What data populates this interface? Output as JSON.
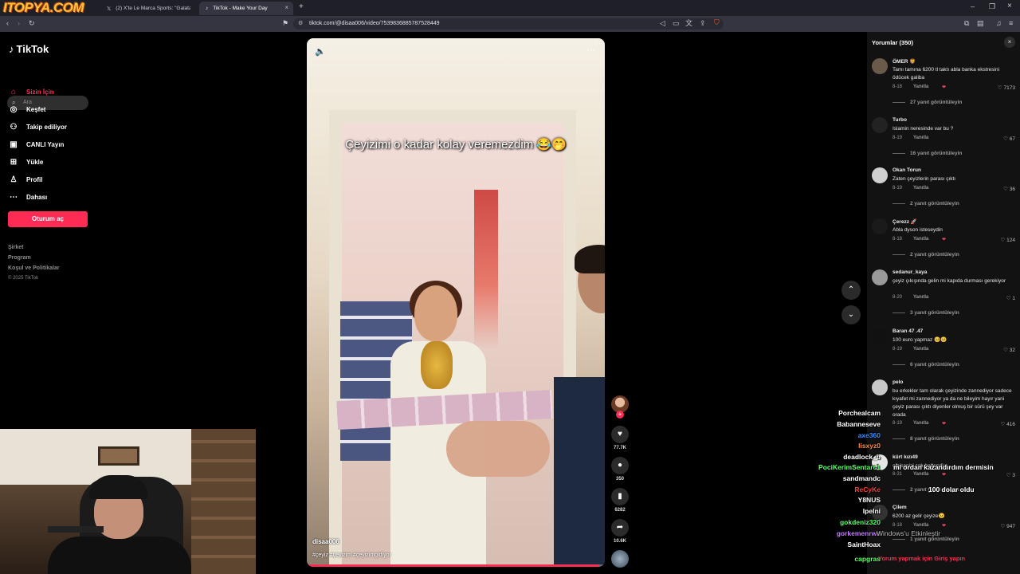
{
  "browser": {
    "watermark": "ITOPYA.COM",
    "tabs": [
      {
        "title": "(2) X'te Le Marca Sports: \"Galatasaray",
        "icon": "x"
      },
      {
        "title": "TikTok - Make Your Day",
        "icon": "tiktok",
        "active": true
      }
    ],
    "new_tab_label": "+",
    "url": "tiktok.com/@disaa006/video/7539836885787528449"
  },
  "sidebar": {
    "logo_text": "TikTok",
    "search_placeholder": "Ara",
    "nav": [
      {
        "label": "Sizin İçin",
        "icon": "home-icon",
        "active": true
      },
      {
        "label": "Keşfet",
        "icon": "compass-icon"
      },
      {
        "label": "Takip ediliyor",
        "icon": "following-icon"
      },
      {
        "label": "CANLI Yayın",
        "icon": "live-icon"
      },
      {
        "label": "Yükle",
        "icon": "upload-icon"
      },
      {
        "label": "Profil",
        "icon": "profile-icon"
      },
      {
        "label": "Dahası",
        "icon": "more-icon"
      }
    ],
    "login_button": "Oturum aç",
    "footer": [
      "Şirket",
      "Program",
      "Koşul ve Politikalar",
      "© 2025 TikTok"
    ]
  },
  "video": {
    "caption": "Çeyizimi o kadar kolay veremezdim 😂🤭",
    "username": "disaa006",
    "hashtags": "#çeyiz #çeyizim #çeyizimgidiyor",
    "progress": 0.98,
    "actions": {
      "likes": "77.7K",
      "comments": "350",
      "saves": "6282",
      "shares": "10.6K"
    }
  },
  "comments_panel": {
    "title": "Yorumlar (350)",
    "reply_label": "Yanıtla",
    "items": [
      {
        "user": "ÖMER 🦁",
        "text": "Tamı tamına 6200 tl taktı abla banka ekstresini ödücek galiba",
        "date": "8-18",
        "likes": "7173",
        "views": "27 yanıt görüntüleyin"
      },
      {
        "user": "Turbo",
        "text": "Islamin neresinde var bu ?",
        "date": "8-19",
        "likes": "67",
        "views": "16 yanıt görüntüleyin"
      },
      {
        "user": "Okan Torun",
        "text": "Zaten çeyizlerin parası çıktı",
        "date": "8-19",
        "likes": "36",
        "views": "2 yanıt görüntüleyin"
      },
      {
        "user": "Çerezz 🚀",
        "text": "Abla dyson isteseydin",
        "date": "8-18",
        "likes": "124",
        "views": "2 yanıt görüntüleyin"
      },
      {
        "user": "sedanur_kaya",
        "text": "çeyiz çıkışında gelin mi kapıda durması gerekiyor",
        "date": "8-20",
        "likes": "1",
        "views": "3 yanıt görüntüleyin"
      },
      {
        "user": "Baran 47 .47",
        "text": "100 euro yapmaz 🥺🥺",
        "date": "8-19",
        "likes": "32",
        "views": "6 yanıt görüntüleyin"
      },
      {
        "user": "pelo",
        "text": "bu erkekler tam olarak çeyizinde zannediyor sadece kıyafet mi zannediyor ya da ne bileyim hayır yani çeyiz parası çıktı diyenler olmuş bir sürü şey var orada",
        "date": "8-19",
        "likes": "416",
        "views": "8 yanıt görüntüleyin"
      },
      {
        "user": "kürt kızı49",
        "text": "elbisenizi çok beğendim",
        "date": "8-31",
        "likes": "3",
        "views": "2 yanıt görüntüleyin"
      },
      {
        "user": "Çilem",
        "text": "6200 az gelir çeyize😉",
        "date": "8-18",
        "likes": "947",
        "views": "1 yanıt görüntüleyin"
      }
    ],
    "login_prompt": "Yorum yapmak için Giriş yapın"
  },
  "stream_chat": {
    "names": [
      {
        "name": "Porchealcam",
        "color": "#ffffff"
      },
      {
        "name": "Babanneseve",
        "color": "#ffffff"
      },
      {
        "name": "axe360",
        "color": "#3a8cff"
      },
      {
        "name": "lisxyz0",
        "color": "#ff8a3d"
      },
      {
        "name": "deadlock_b",
        "color": "#ffffff"
      },
      {
        "name": "PociKerimSentarc1",
        "color": "#5cff6a"
      },
      {
        "name": "sandmandc",
        "color": "#ffffff"
      },
      {
        "name": "ReCyKe",
        "color": "#ff3b3b"
      },
      {
        "name": "Y8NUS",
        "color": "#ffffff"
      },
      {
        "name": "Ipelni",
        "color": "#ffffff"
      },
      {
        "name": "gokdeniz320",
        "color": "#5cff6a"
      },
      {
        "name": "gorkemenrws",
        "color": "#c27bff"
      },
      {
        "name": "SaintHoax",
        "color": "#ffffff"
      },
      {
        "name": "capgras",
        "color": "#5cff6a"
      }
    ],
    "messages": [
      "mi ordan kazandırdım dermisin",
      "100 dolar oldu",
      "Windows'u Etkinleştir"
    ]
  }
}
